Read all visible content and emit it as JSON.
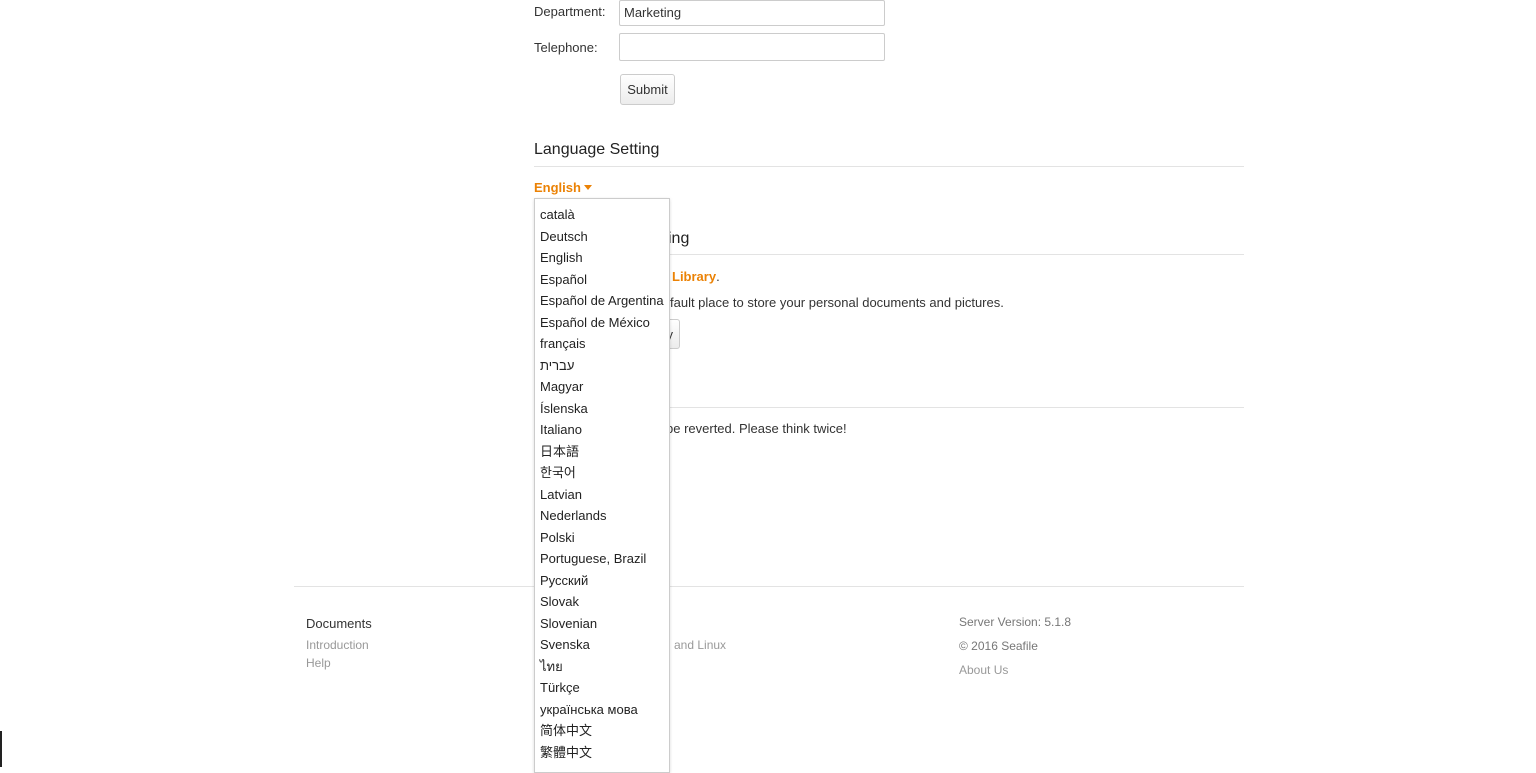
{
  "profile_form": {
    "department_label": "Department:",
    "department_value": "Marketing",
    "telephone_label": "Telephone:",
    "telephone_value": "",
    "submit_label": "Submit"
  },
  "language_setting": {
    "title": "Language Setting",
    "current": "English",
    "options": [
      "català",
      "Deutsch",
      "English",
      "Español",
      "Español de Argentina",
      "Español de México",
      "français",
      "עברית",
      "Magyar",
      "Íslenska",
      "Italiano",
      "日本語",
      "한국어",
      "Latvian",
      "Nederlands",
      "Polski",
      "Portuguese, Brazil",
      "Русский",
      "Slovak",
      "Slovenian",
      "Svenska",
      "ไทย",
      "Türkçe",
      "українська мова",
      "简体中文",
      "繁體中文"
    ]
  },
  "hidden_section": {
    "title_partial": "ing",
    "link_partial": "Library",
    "link_suffix": ".",
    "description_partial": "fault place to store your personal documents and pictures.",
    "button_partial": "y",
    "warning_partial": "be reverted. Please think twice!"
  },
  "footer": {
    "documents_title": "Documents",
    "doc_links": [
      "Introduction",
      "Help"
    ],
    "clients_partial": "and Linux",
    "server_version": "Server Version: 5.1.8",
    "copyright": "© 2016 Seafile",
    "about": "About Us"
  }
}
